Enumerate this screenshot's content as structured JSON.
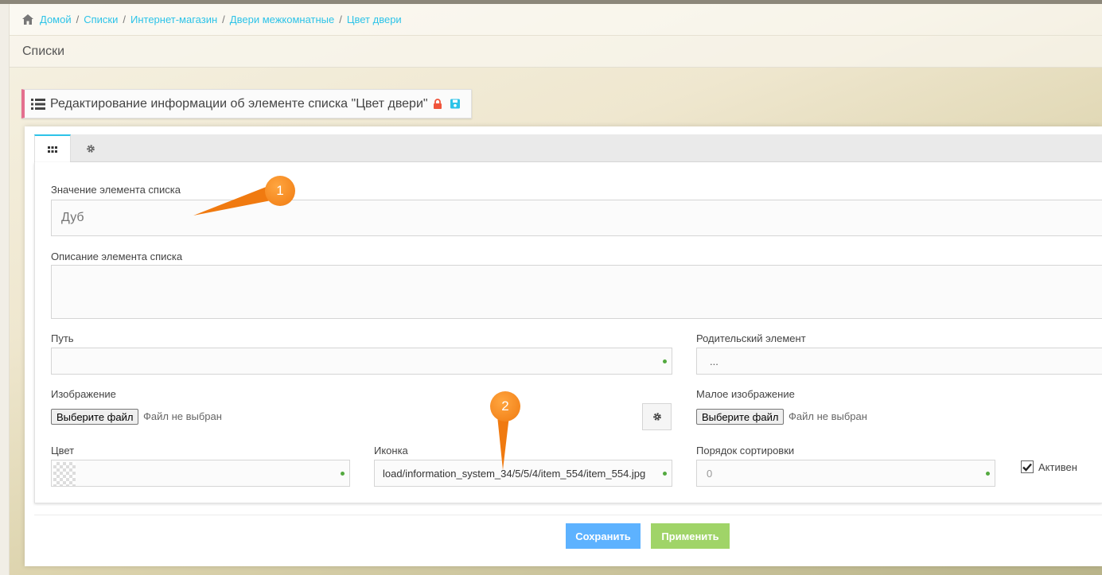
{
  "breadcrumb": {
    "items": [
      {
        "label": "Домой"
      },
      {
        "label": "Списки"
      },
      {
        "label": "Интернет-магазин"
      },
      {
        "label": "Двери межкомнатные"
      },
      {
        "label": "Цвет двери"
      }
    ]
  },
  "page_header": {
    "title": "Списки"
  },
  "widget": {
    "title": "Редактирование информации об элементе списка \"Цвет двери\""
  },
  "tabs": [
    {
      "icon": "grid-icon"
    },
    {
      "icon": "gear-icon"
    }
  ],
  "form": {
    "value_label": "Значение элемента списка",
    "value_placeholder": "Дуб",
    "description_label": "Описание элемента списка",
    "path_label": "Путь",
    "parent_label": "Родительский элемент",
    "parent_value": "...",
    "image_label": "Изображение",
    "image_button": "Выберите файл",
    "image_status": "Файл не выбран",
    "small_image_label": "Малое изображение",
    "small_image_button": "Выберите файл",
    "small_image_status": "Файл не выбран",
    "color_label": "Цвет",
    "icon_label": "Иконка",
    "icon_value": "load/information_system_34/5/5/4/item_554/item_554.jpg",
    "sort_label": "Порядок сортировки",
    "sort_placeholder": "0",
    "active_label": "Активен",
    "active_checked": true
  },
  "buttons": {
    "save": "Сохранить",
    "apply": "Применить"
  },
  "annotations": [
    {
      "label": "1"
    },
    {
      "label": "2"
    }
  ],
  "colors": {
    "accent": "#2dc3e8",
    "save": "#5db2ff",
    "apply": "#a0d468",
    "marker": "#f07a10",
    "title_border": "#e46f8f"
  }
}
